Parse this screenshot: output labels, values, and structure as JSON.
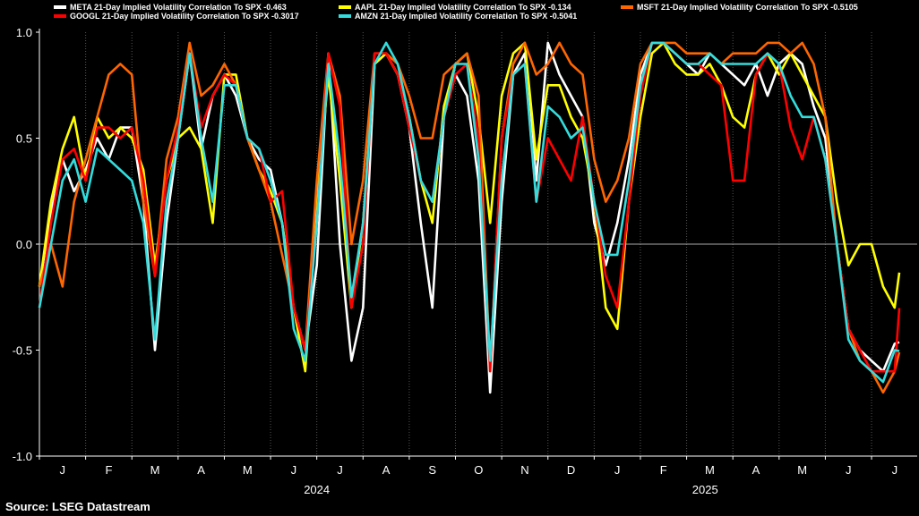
{
  "source_note": "Source: LSEG Datastream",
  "chart_data": {
    "type": "line",
    "title": "",
    "xlabel": "",
    "ylabel": "",
    "ylim": [
      -1.0,
      1.0
    ],
    "yticks": [
      "1.0",
      "0.5",
      "0.0",
      "-0.5",
      "-1.0"
    ],
    "ytick_values": [
      1.0,
      0.5,
      0.0,
      -0.5,
      -1.0
    ],
    "xtick_labels": [
      "J",
      "F",
      "M",
      "A",
      "M",
      "J",
      "J",
      "A",
      "S",
      "O",
      "N",
      "D",
      "J",
      "F",
      "M",
      "A",
      "M",
      "J",
      "J"
    ],
    "year_labels": [
      "2024",
      "2025"
    ],
    "x": [
      0,
      0.25,
      0.5,
      0.75,
      1,
      1.25,
      1.5,
      1.75,
      2,
      2.25,
      2.5,
      2.75,
      3,
      3.25,
      3.5,
      3.75,
      4,
      4.25,
      4.5,
      4.75,
      5,
      5.25,
      5.5,
      5.75,
      6,
      6.25,
      6.5,
      6.75,
      7,
      7.25,
      7.5,
      7.75,
      8,
      8.25,
      8.5,
      8.75,
      9,
      9.25,
      9.5,
      9.75,
      10,
      10.25,
      10.5,
      10.75,
      11,
      11.25,
      11.5,
      11.75,
      12,
      12.25,
      12.5,
      12.75,
      13,
      13.25,
      13.5,
      13.75,
      14,
      14.25,
      14.5,
      14.75,
      15,
      15.25,
      15.5,
      15.75,
      16,
      16.25,
      16.5,
      16.75,
      17,
      17.25,
      17.5,
      17.75,
      18,
      18.25,
      18.5,
      18.6
    ],
    "grid": "dotted vertical",
    "legend_position": "top",
    "series": [
      {
        "name": "META 21-Day Implied Volatility Correlation To SPX -0.463",
        "color": "#ffffff",
        "values": [
          -0.2,
          0.15,
          0.4,
          0.25,
          0.35,
          0.5,
          0.4,
          0.55,
          0.55,
          0.2,
          -0.5,
          0.1,
          0.5,
          0.9,
          0.45,
          0.7,
          0.8,
          0.7,
          0.5,
          0.4,
          0.35,
          0.1,
          -0.3,
          -0.5,
          -0.1,
          0.9,
          0.0,
          -0.55,
          -0.3,
          0.85,
          0.9,
          0.8,
          0.55,
          0.1,
          -0.3,
          0.6,
          0.8,
          0.7,
          0.3,
          -0.7,
          0.2,
          0.8,
          0.9,
          0.3,
          0.95,
          0.8,
          0.7,
          0.6,
          0.1,
          -0.1,
          0.1,
          0.4,
          0.8,
          0.95,
          0.95,
          0.9,
          0.85,
          0.8,
          0.9,
          0.85,
          0.8,
          0.75,
          0.85,
          0.7,
          0.85,
          0.9,
          0.85,
          0.65,
          0.5,
          0.0,
          -0.4,
          -0.5,
          -0.55,
          -0.6,
          -0.47,
          -0.463
        ]
      },
      {
        "name": "AAPL 21-Day Implied Volatility Correlation To SPX -0.134",
        "color": "#ffff00",
        "values": [
          -0.2,
          0.2,
          0.45,
          0.6,
          0.3,
          0.6,
          0.5,
          0.55,
          0.5,
          0.35,
          -0.1,
          0.3,
          0.5,
          0.55,
          0.45,
          0.1,
          0.8,
          0.8,
          0.5,
          0.35,
          0.25,
          0.1,
          -0.3,
          -0.6,
          0.2,
          0.8,
          0.3,
          -0.3,
          0.1,
          0.85,
          0.9,
          0.8,
          0.6,
          0.3,
          0.1,
          0.65,
          0.85,
          0.9,
          0.6,
          0.1,
          0.7,
          0.9,
          0.95,
          0.4,
          0.75,
          0.75,
          0.6,
          0.5,
          0.2,
          -0.3,
          -0.4,
          0.2,
          0.6,
          0.9,
          0.95,
          0.85,
          0.8,
          0.8,
          0.85,
          0.75,
          0.6,
          0.55,
          0.8,
          0.9,
          0.8,
          0.9,
          0.8,
          0.7,
          0.6,
          0.2,
          -0.1,
          0.0,
          0.0,
          -0.2,
          -0.3,
          -0.134
        ]
      },
      {
        "name": "MSFT 21-Day Implied Volatility Correlation To SPX -0.5105",
        "color": "#ff6600",
        "values": [
          -0.2,
          0.0,
          -0.2,
          0.2,
          0.4,
          0.6,
          0.8,
          0.85,
          0.8,
          0.2,
          -0.15,
          0.4,
          0.6,
          0.95,
          0.7,
          0.75,
          0.85,
          0.75,
          0.5,
          0.35,
          0.2,
          -0.05,
          -0.3,
          -0.5,
          0.3,
          0.9,
          0.7,
          0.0,
          0.3,
          0.9,
          0.9,
          0.85,
          0.7,
          0.5,
          0.5,
          0.8,
          0.85,
          0.9,
          0.7,
          -0.6,
          0.5,
          0.85,
          0.95,
          0.8,
          0.85,
          0.95,
          0.85,
          0.8,
          0.4,
          0.2,
          0.3,
          0.5,
          0.85,
          0.95,
          0.95,
          0.95,
          0.9,
          0.9,
          0.9,
          0.85,
          0.9,
          0.9,
          0.9,
          0.95,
          0.95,
          0.9,
          0.95,
          0.85,
          0.6,
          0.0,
          -0.4,
          -0.55,
          -0.6,
          -0.7,
          -0.6,
          -0.5105
        ]
      },
      {
        "name": "GOOGL 21-Day Implied Volatility Correlation To SPX -0.3017",
        "color": "#ff0000",
        "values": [
          -0.3,
          0.1,
          0.4,
          0.45,
          0.3,
          0.55,
          0.55,
          0.5,
          0.55,
          0.3,
          -0.15,
          0.3,
          0.55,
          0.9,
          0.55,
          0.7,
          0.8,
          0.75,
          0.5,
          0.45,
          0.2,
          0.25,
          -0.3,
          -0.5,
          0.1,
          0.9,
          0.65,
          -0.3,
          0.0,
          0.9,
          0.9,
          0.8,
          0.55,
          0.3,
          0.2,
          0.6,
          0.8,
          0.85,
          0.5,
          -0.6,
          0.5,
          0.8,
          0.85,
          0.2,
          0.5,
          0.4,
          0.3,
          0.6,
          0.2,
          -0.15,
          -0.3,
          0.2,
          0.7,
          0.95,
          0.95,
          0.9,
          0.85,
          0.85,
          0.8,
          0.75,
          0.3,
          0.3,
          0.8,
          0.9,
          0.85,
          0.55,
          0.4,
          0.6,
          0.4,
          0.0,
          -0.4,
          -0.5,
          -0.6,
          -0.6,
          -0.6,
          -0.3017
        ]
      },
      {
        "name": "AMZN 21-Day Implied Volatility Correlation To SPX -0.5041",
        "color": "#33dddd",
        "values": [
          -0.3,
          0.0,
          0.3,
          0.4,
          0.2,
          0.45,
          0.4,
          0.35,
          0.3,
          0.1,
          -0.45,
          0.2,
          0.5,
          0.9,
          0.5,
          0.2,
          0.75,
          0.75,
          0.5,
          0.45,
          0.3,
          0.1,
          -0.4,
          -0.55,
          0.1,
          0.85,
          0.4,
          -0.25,
          0.1,
          0.85,
          0.95,
          0.85,
          0.6,
          0.3,
          0.2,
          0.6,
          0.85,
          0.85,
          0.4,
          -0.55,
          0.3,
          0.8,
          0.85,
          0.2,
          0.65,
          0.6,
          0.5,
          0.55,
          0.2,
          -0.05,
          -0.05,
          0.3,
          0.75,
          0.95,
          0.95,
          0.9,
          0.85,
          0.85,
          0.9,
          0.85,
          0.85,
          0.85,
          0.85,
          0.9,
          0.85,
          0.7,
          0.6,
          0.6,
          0.4,
          0.0,
          -0.45,
          -0.55,
          -0.6,
          -0.65,
          -0.5,
          -0.5041
        ]
      }
    ]
  }
}
